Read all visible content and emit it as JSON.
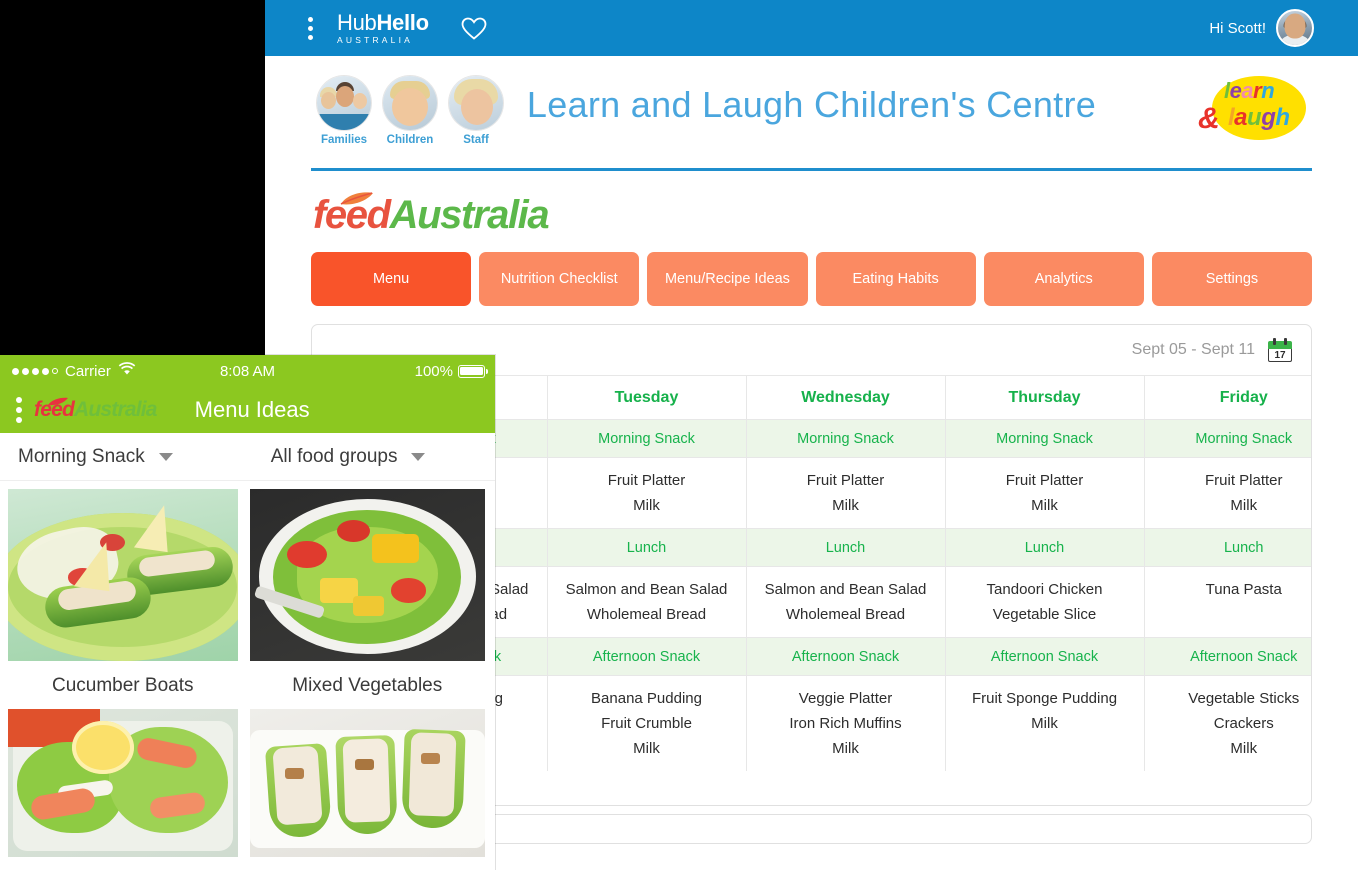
{
  "topbar": {
    "menu_icon": "kebab-menu-icon",
    "brand_main": "Hub",
    "brand_bold": "Hello",
    "brand_sub": "AUSTRALIA",
    "favourites_icon": "heart-icon",
    "greeting": "Hi Scott!",
    "avatar": "user-avatar"
  },
  "centre": {
    "title": "Learn and Laugh Children's Centre",
    "people": [
      {
        "label": "Families",
        "icon": "families-avatar"
      },
      {
        "label": "Children",
        "icon": "children-avatar"
      },
      {
        "label": "Staff",
        "icon": "staff-avatar"
      }
    ],
    "logo": {
      "line1": "learn",
      "line2": "laugh",
      "amp": "&"
    }
  },
  "brand": {
    "part1": "feed",
    "part2": "Australia"
  },
  "tabs": [
    {
      "label": "Menu",
      "active": true
    },
    {
      "label": "Nutrition Checklist",
      "active": false
    },
    {
      "label": "Menu/Recipe Ideas",
      "active": false
    },
    {
      "label": "Eating Habits",
      "active": false
    },
    {
      "label": "Analytics",
      "active": false
    },
    {
      "label": "Settings",
      "active": false
    }
  ],
  "menu_panel": {
    "date_range": "Sept 05 - Sept 11",
    "calendar_icon_day": "17",
    "days": [
      "Tuesday",
      "Wednesday",
      "Thursday",
      "Friday"
    ],
    "meal_rows": [
      {
        "meal": "Morning Snack",
        "cells": [
          [
            "Fruit Platter",
            "Milk"
          ],
          [
            "Fruit Platter",
            "Milk"
          ],
          [
            "Fruit Platter",
            "Milk"
          ],
          [
            "Fruit Platter",
            "Milk"
          ]
        ]
      },
      {
        "meal": "Lunch",
        "cells": [
          [
            "Salmon and Bean Salad",
            "Wholemeal Bread"
          ],
          [
            "Salmon and Bean Salad",
            "Wholemeal Bread"
          ],
          [
            "Tandoori Chicken",
            "Vegetable Slice"
          ],
          [
            "Tuna Pasta"
          ]
        ]
      },
      {
        "meal": "Afternoon Snack",
        "cells": [
          [
            "Banana Pudding",
            "Fruit Crumble",
            "Milk"
          ],
          [
            "Veggie Platter",
            "Iron Rich Muffins",
            "Milk"
          ],
          [
            "Fruit Sponge Pudding",
            "Milk"
          ],
          [
            "Vegetable Sticks",
            "Crackers",
            "Milk"
          ]
        ]
      }
    ]
  },
  "phone": {
    "status": {
      "carrier": "Carrier",
      "signal_icon": "signal-dots-icon",
      "wifi_icon": "wifi-icon",
      "time": "8:08 AM",
      "battery_percent": "100%",
      "battery_icon": "battery-full-icon"
    },
    "navbar": {
      "menu_icon": "kebab-menu-icon",
      "brand_part1": "feed",
      "brand_part2": "Australia",
      "title": "Menu Ideas"
    },
    "filters": [
      {
        "value": "Morning Snack",
        "icon": "chevron-down-icon"
      },
      {
        "value": "All food groups",
        "icon": "chevron-down-icon"
      }
    ],
    "cards": [
      {
        "caption": "Cucumber Boats",
        "image": "cucumber-boats-photo"
      },
      {
        "caption": "Mixed Vegetables",
        "image": "mixed-vegetables-photo"
      },
      {
        "caption": "",
        "image": "salmon-lettuce-cups-photo"
      },
      {
        "caption": "",
        "image": "celery-sticks-photo"
      }
    ]
  },
  "colors": {
    "header_blue": "#0d86c8",
    "tab_active": "#f9542a",
    "tab_inactive": "#fb8a62",
    "green_text": "#16b14b",
    "meal_row_bg": "#ecf6e8",
    "phone_green": "#8cc820"
  }
}
